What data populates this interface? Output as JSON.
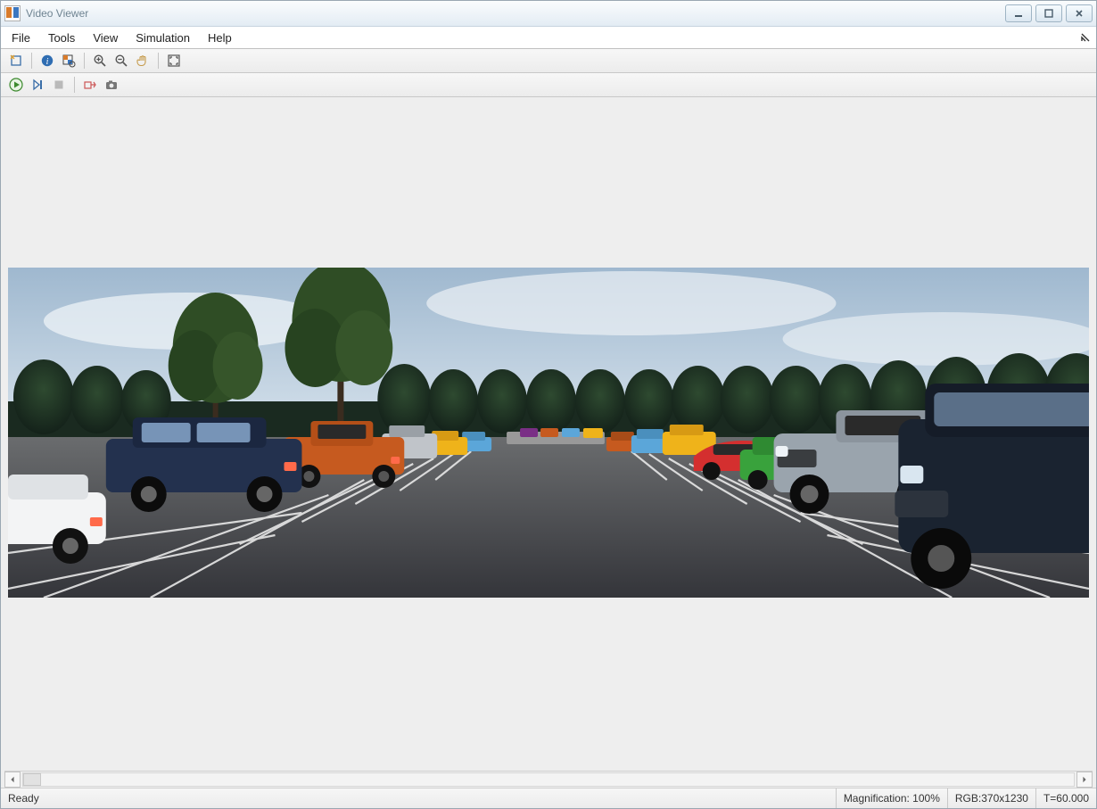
{
  "window": {
    "title": "Video Viewer"
  },
  "menubar": {
    "items": [
      "File",
      "Tools",
      "View",
      "Simulation",
      "Help"
    ]
  },
  "toolbar1": {
    "icons": [
      "new-colormap-icon",
      "info-icon",
      "pixel-region-icon",
      "zoom-in-icon",
      "zoom-out-icon",
      "pan-icon",
      "fit-to-window-icon"
    ]
  },
  "toolbar2": {
    "icons": [
      "play-icon",
      "step-icon",
      "stop-icon",
      "highlight-block-icon",
      "snapshot-icon"
    ]
  },
  "statusbar": {
    "ready": "Ready",
    "magnification": "Magnification: 100%",
    "rgb": "RGB:370x1230",
    "time": "T=60.000"
  },
  "scene": {
    "description": "Rendered 3D parking lot viewed from ground level. Cloudy blue sky, a row of dark green trees along the horizon, two taller trees left-of-center. Asphalt parking lot with white stall lines converging toward a central vanishing point. Rows of parked vehicles on both sides in assorted colors.",
    "sky_top": "#9fb8cf",
    "sky_bottom": "#d6e2ec",
    "treeline": "#1d2e22",
    "tree_fg": "#2f4d25",
    "asphalt_near": "#3c3c3e",
    "asphalt_far": "#6a6c6e",
    "line_color": "#e8e8e8",
    "car_colors_left": [
      "#ffffff",
      "#23314e",
      "#c65a1f",
      "#efb31a",
      "#5ba6d9",
      "#7a2f86"
    ],
    "car_colors_right": [
      "#1a2330",
      "#9aa4ad",
      "#39a23c",
      "#d42f2f",
      "#efb31a",
      "#5ba6d9",
      "#c65a1f"
    ]
  }
}
